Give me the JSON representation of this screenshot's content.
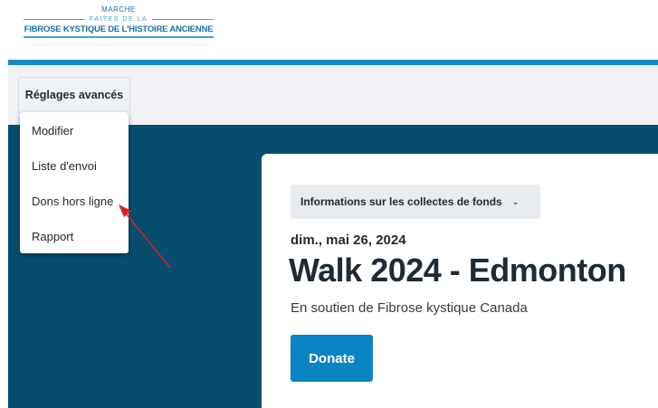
{
  "logo": {
    "line1": "MARCHE",
    "line2": "FAITES DE LA",
    "line3": "FIBROSE KYSTIQUE DE L'HISTOIRE ANCIENNE"
  },
  "admin": {
    "settings_button": "Réglages avancés",
    "menu_items": [
      "Modifier",
      "Liste d'envoi",
      "Dons hors ligne",
      "Rapport"
    ]
  },
  "event": {
    "fundraising_dropdown": "Informations sur les collectes de fonds",
    "date": "dim., mai 26, 2024",
    "title": "Walk 2024 - Edmonton",
    "subtitle": "En soutien de Fibrose kystique Canada",
    "donate_label": "Donate"
  },
  "annotation": {
    "arrow_color": "#e02020",
    "points_to": "Dons hors ligne"
  },
  "colors": {
    "brand_blue": "#1f87bf",
    "hero_bg": "#094d6e",
    "donate_bg": "#0b84c4"
  }
}
